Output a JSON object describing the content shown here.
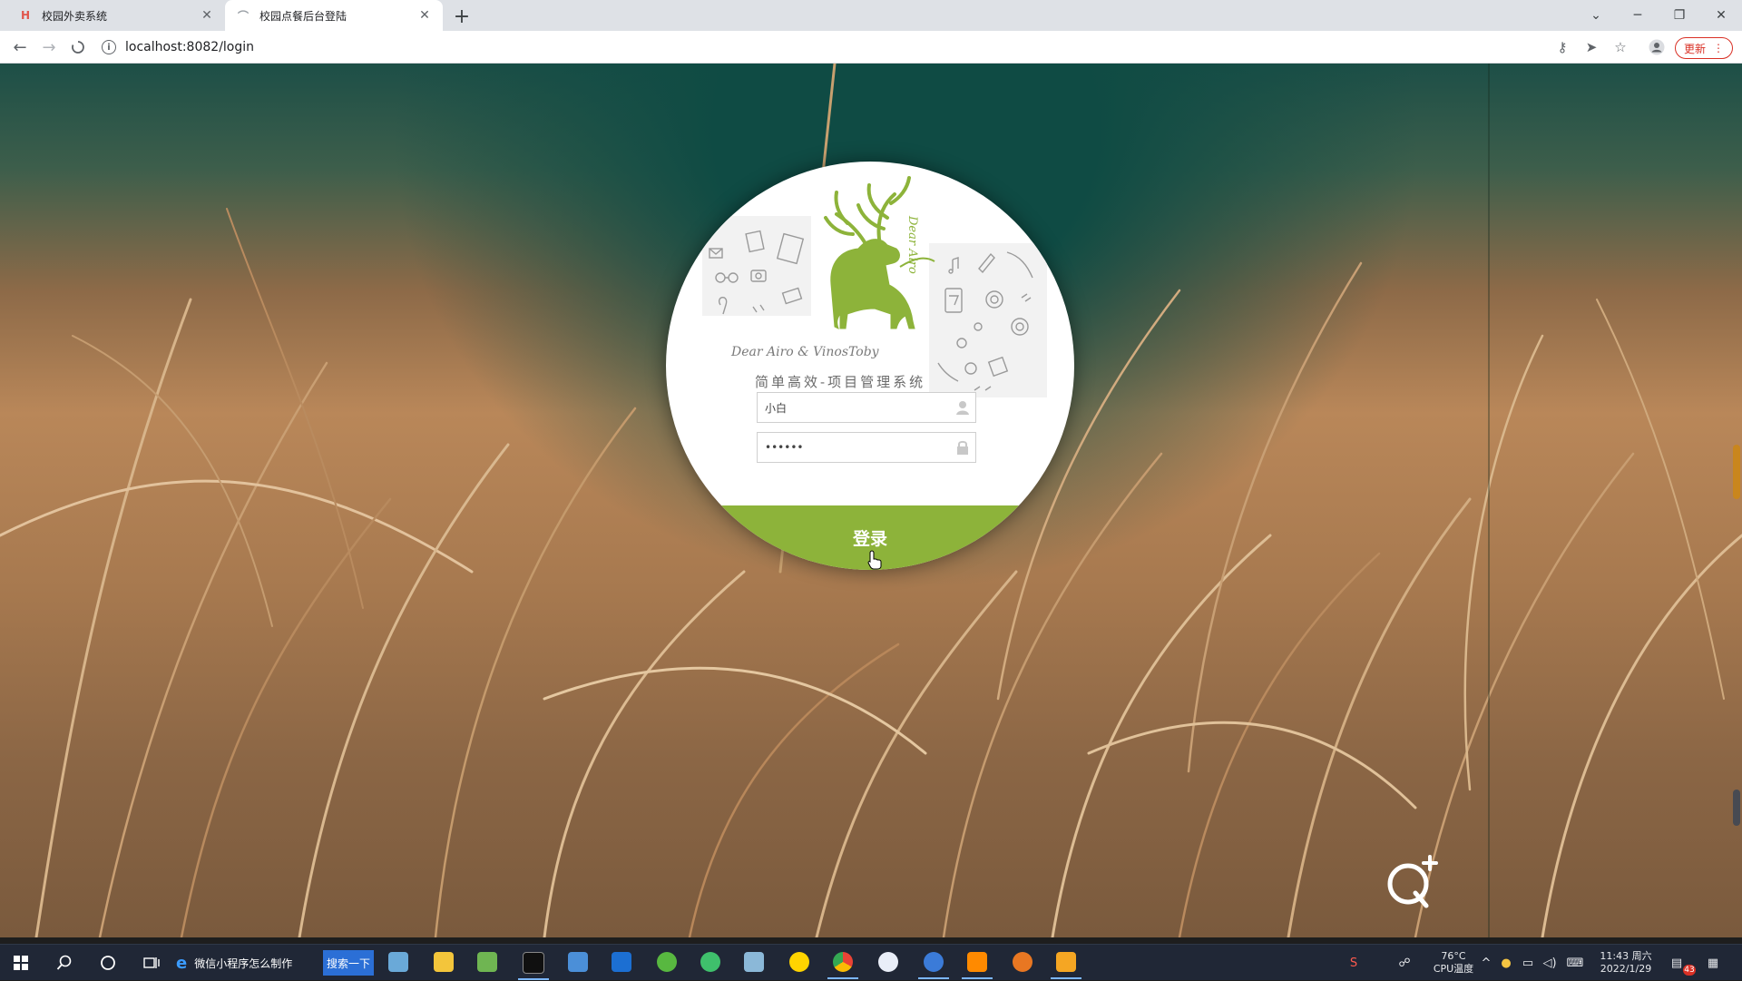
{
  "browser": {
    "tabs": [
      {
        "title": "校园外卖系统",
        "favicon": "H"
      },
      {
        "title": "校园点餐后台登陆",
        "favicon": ""
      }
    ],
    "url": "localhost:8082/login",
    "update_label": "更新"
  },
  "login": {
    "credit": "Dear Airo & VinosToby",
    "system_title": "简单高效-项目管理系统",
    "logo_text": "Dear Airo",
    "username_value": "小白",
    "password_value": "••••••",
    "submit_label": "登录",
    "accent_color": "#8db33a"
  },
  "taskbar": {
    "search_text": "微信小程序怎么制作",
    "search_button": "搜索一下",
    "temperature": "76°C",
    "cpu_label": "CPU温度",
    "time": "11:43 周六",
    "date": "2022/1/29",
    "notification_count": "43"
  }
}
